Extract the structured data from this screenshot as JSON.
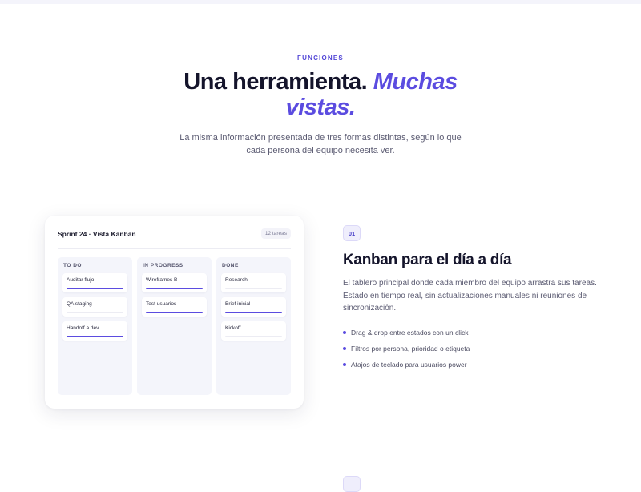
{
  "section": {
    "eyebrow": "FUNCIONES",
    "title_plain": "Una herramienta.",
    "title_accent": "Muchas vistas.",
    "subtitle": "La misma información presentada de tres formas distintas, según lo que cada persona del equipo necesita ver."
  },
  "board": {
    "title": "Sprint 24 · Vista Kanban",
    "count": "12 tareas",
    "columns": [
      {
        "title": "TO DO",
        "tasks": [
          {
            "label": "Auditar flujo",
            "progress": 1.0
          },
          {
            "label": "QA staging",
            "progress": 0
          },
          {
            "label": "Handoff a dev",
            "progress": 1.0
          }
        ]
      },
      {
        "title": "IN PROGRESS",
        "tasks": [
          {
            "label": "Wireframes B",
            "progress": 1.0
          },
          {
            "label": "Test usuarios",
            "progress": 1.0
          }
        ]
      },
      {
        "title": "DONE",
        "tasks": [
          {
            "label": "Research",
            "progress": 0
          },
          {
            "label": "Brief inicial",
            "progress": 1.0
          },
          {
            "label": "Kickoff",
            "progress": 0
          }
        ]
      }
    ]
  },
  "feature": {
    "number": "01",
    "title": "Kanban para el día a día",
    "description": "El tablero principal donde cada miembro del equipo arrastra sus tareas. Estado en tiempo real, sin actualizaciones manuales ni reuniones de sincronización.",
    "bullets": [
      "Drag & drop entre estados con un click",
      "Filtros por persona, prioridad o etiqueta",
      "Atajos de teclado para usuarios power"
    ]
  },
  "colors": {
    "accent": "#5b4ce0",
    "text": "#14142b",
    "muted": "#5b5b72"
  }
}
